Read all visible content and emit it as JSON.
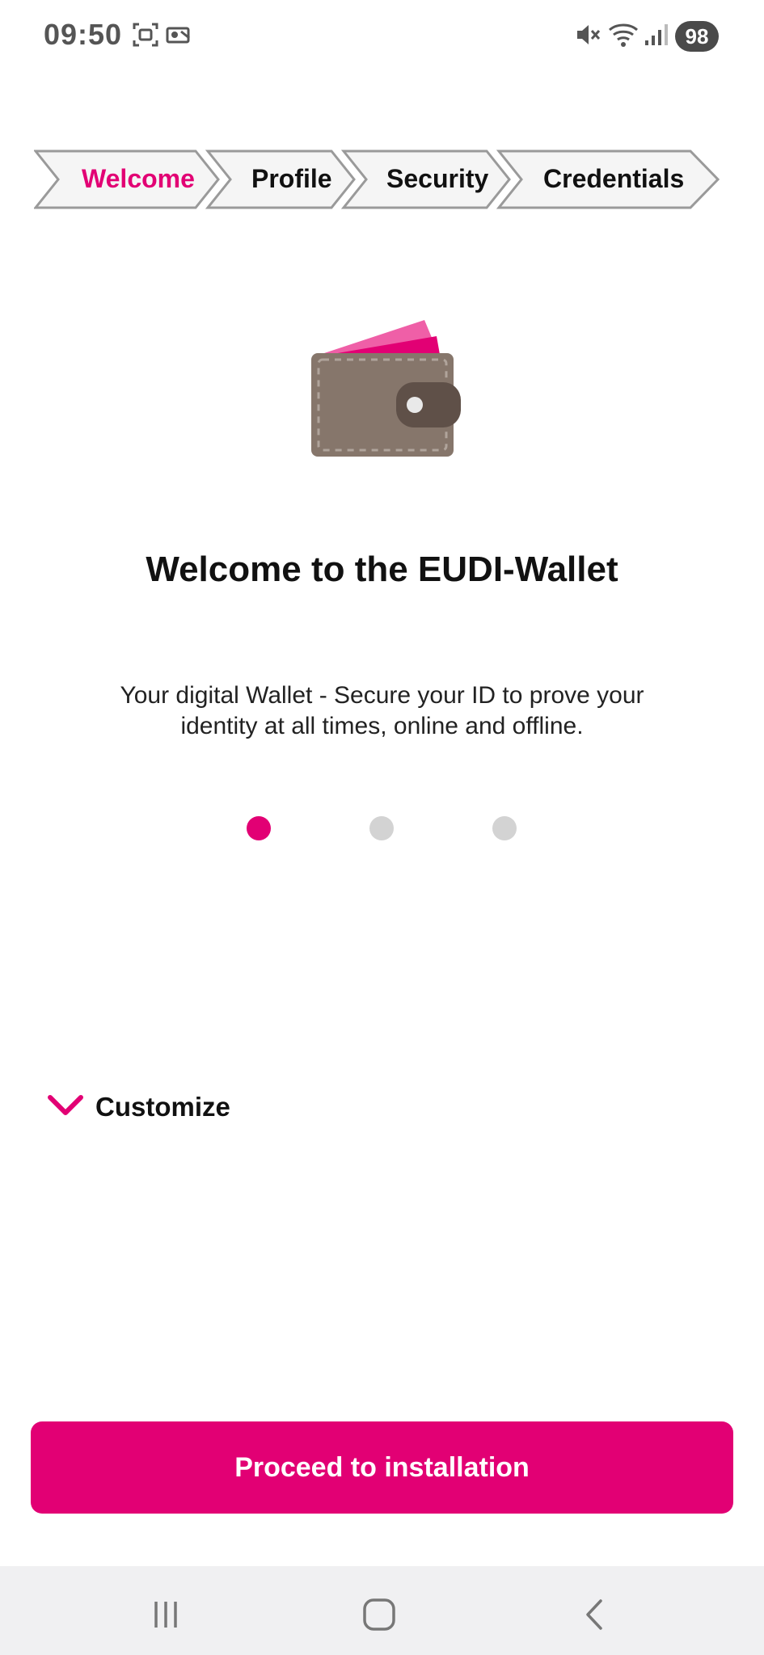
{
  "status_bar": {
    "time": "09:50",
    "battery": "98",
    "icons": [
      "screenshot-icon",
      "cast-icon",
      "mute-icon",
      "wifi-icon",
      "signal-icon"
    ]
  },
  "stepper": {
    "steps": [
      {
        "label": "Welcome",
        "active": true
      },
      {
        "label": "Profile",
        "active": false
      },
      {
        "label": "Security",
        "active": false
      },
      {
        "label": "Credentials",
        "active": false
      }
    ]
  },
  "illustration": "wallet-icon",
  "main": {
    "title": "Welcome to the EUDI-Wallet",
    "description": "Your digital Wallet - Secure your ID to prove your identity at all times, online and offline.",
    "carousel": {
      "total": 3,
      "active": 1
    }
  },
  "customize": {
    "label": "Customize"
  },
  "primary_button": {
    "label": "Proceed to installation"
  },
  "nav_bar": {
    "buttons": [
      "recents-icon",
      "home-icon",
      "back-icon"
    ]
  },
  "colors": {
    "accent": "#e20074",
    "inactive_dot": "#d3d3d3",
    "nav_background": "#f0f0f2"
  }
}
